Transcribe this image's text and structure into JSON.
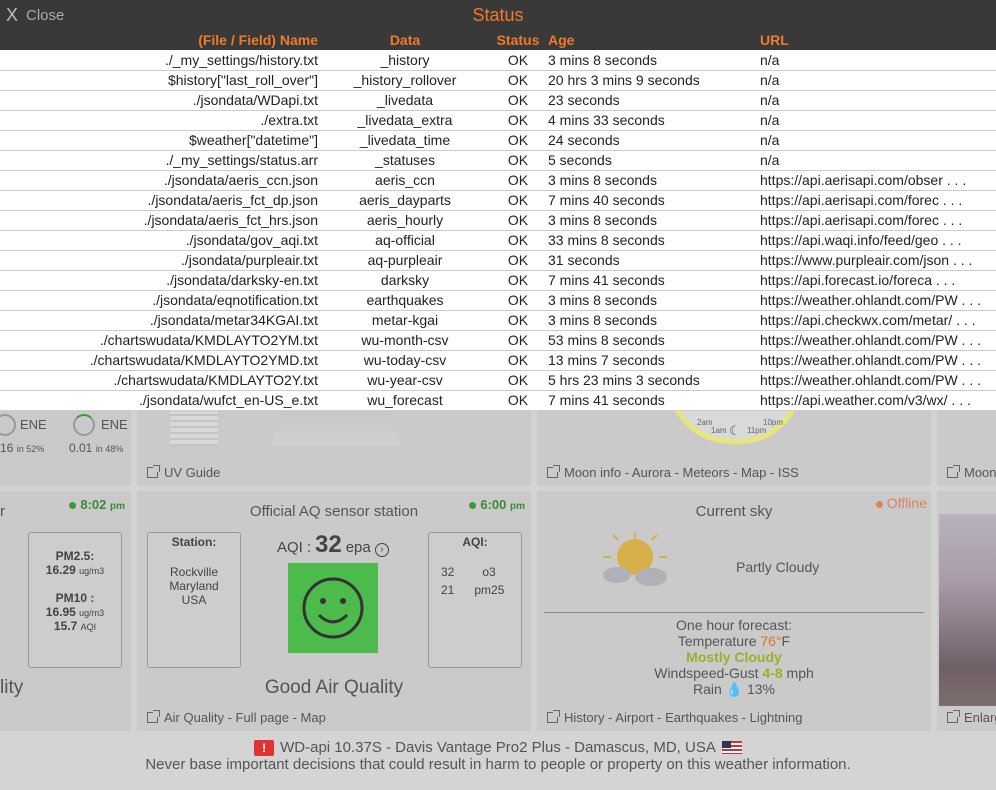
{
  "modal": {
    "close_x": "X",
    "close_label": "Close",
    "title": "Status",
    "columns": {
      "name": "(File / Field) Name",
      "data": "Data",
      "status": "Status",
      "age": "Age",
      "url": "URL"
    },
    "rows": [
      {
        "name": "./_my_settings/history.txt",
        "data": "_history",
        "status": "OK",
        "age": "3 mins 8 seconds",
        "url": "n/a"
      },
      {
        "name": "$history[\"last_roll_over\"]",
        "data": "_history_rollover",
        "status": "OK",
        "age": "20 hrs 3 mins 9 seconds",
        "url": "n/a"
      },
      {
        "name": "./jsondata/WDapi.txt",
        "data": "_livedata",
        "status": "OK",
        "age": "23 seconds",
        "url": "n/a"
      },
      {
        "name": "./extra.txt",
        "data": "_livedata_extra",
        "status": "OK",
        "age": "4 mins 33 seconds",
        "url": "n/a"
      },
      {
        "name": "$weather[\"datetime\"]",
        "data": "_livedata_time",
        "status": "OK",
        "age": "24 seconds",
        "url": "n/a"
      },
      {
        "name": "./_my_settings/status.arr",
        "data": "_statuses",
        "status": "OK",
        "age": "5 seconds",
        "url": "n/a"
      },
      {
        "name": "./jsondata/aeris_ccn.json",
        "data": "aeris_ccn",
        "status": "OK",
        "age": "3 mins 8 seconds",
        "url": "https://api.aerisapi.com/obser . . ."
      },
      {
        "name": "./jsondata/aeris_fct_dp.json",
        "data": "aeris_dayparts",
        "status": "OK",
        "age": "7 mins 40 seconds",
        "url": "https://api.aerisapi.com/forec . . ."
      },
      {
        "name": "./jsondata/aeris_fct_hrs.json",
        "data": "aeris_hourly",
        "status": "OK",
        "age": "3 mins 8 seconds",
        "url": "https://api.aerisapi.com/forec . . ."
      },
      {
        "name": "./jsondata/gov_aqi.txt",
        "data": "aq-official",
        "status": "OK",
        "age": "33 mins 8 seconds",
        "url": "https://api.waqi.info/feed/geo . . ."
      },
      {
        "name": "./jsondata/purpleair.txt",
        "data": "aq-purpleair",
        "status": "OK",
        "age": "31 seconds",
        "url": "https://www.purpleair.com/json . . ."
      },
      {
        "name": "./jsondata/darksky-en.txt",
        "data": "darksky",
        "status": "OK",
        "age": "7 mins 41 seconds",
        "url": "https://api.forecast.io/foreca . . ."
      },
      {
        "name": "./jsondata/eqnotification.txt",
        "data": "earthquakes",
        "status": "OK",
        "age": "3 mins 8 seconds",
        "url": "https://weather.ohlandt.com/PW . . ."
      },
      {
        "name": "./jsondata/metar34KGAI.txt",
        "data": "metar-kgai",
        "status": "OK",
        "age": "3 mins 8 seconds",
        "url": "https://api.checkwx.com/metar/ . . ."
      },
      {
        "name": "./chartswudata/KMDLAYTO2YM.txt",
        "data": "wu-month-csv",
        "status": "OK",
        "age": "53 mins 8 seconds",
        "url": "https://weather.ohlandt.com/PW . . ."
      },
      {
        "name": "./chartswudata/KMDLAYTO2YMD.txt",
        "data": "wu-today-csv",
        "status": "OK",
        "age": "13 mins 7 seconds",
        "url": "https://weather.ohlandt.com/PW . . ."
      },
      {
        "name": "./chartswudata/KMDLAYTO2Y.txt",
        "data": "wu-year-csv",
        "status": "OK",
        "age": "5 hrs 23 mins 3 seconds",
        "url": "https://weather.ohlandt.com/PW . . ."
      },
      {
        "name": "./jsondata/wufct_en-US_e.txt",
        "data": "wu_forecast",
        "status": "OK",
        "age": "7 mins 41 seconds",
        "url": "https://api.weather.com/v3/wx/ . . ."
      }
    ]
  },
  "dashboard": {
    "wind": {
      "dir1": "ENE",
      "dir2": "ENE",
      "val1": "16",
      "pct1": "in 52%",
      "val2": "0.01",
      "pct2": "in 48%"
    },
    "uv_link": "UV Guide",
    "moon": {
      "link": "Moon info - Aurora - Meteors - Map - ISS",
      "t1": "2am",
      "t2": "10pm",
      "t3": "1am",
      "t4": "11pm"
    },
    "moon_right_link": "Moon",
    "aq_left": {
      "time": "8:02",
      "time_suffix": "pm",
      "pm25_label": "PM2.5",
      "pm25_value": "16.29",
      "pm25_unit": "ug/m3",
      "pm10_label": "PM10",
      "pm10_value": "16.95",
      "pm10_unit": "ug/m3",
      "pm10_aqi": "15.7",
      "aqi_unit": "AQI",
      "footer_partial": "lity"
    },
    "aq_official": {
      "title": "Official AQ sensor station",
      "time": "6:00",
      "time_suffix": "pm",
      "station_label": "Station",
      "station_lines": [
        "Rockville",
        "Maryland",
        "USA"
      ],
      "aqi_label": "AQI",
      "aqi_value": "32",
      "aqi_unit": "epa",
      "aqi_right_label": "AQI",
      "aqi_rows": [
        {
          "v": "32",
          "k": "o3"
        },
        {
          "v": "21",
          "k": "pm25"
        }
      ],
      "quality": "Good Air Quality",
      "link": "Air Quality - Full page - Map",
      "face_color": "#4cbb4c"
    },
    "current_sky": {
      "title": "Current sky",
      "status": "Offline",
      "condition": "Partly Cloudy",
      "forecast_title": "One hour forecast:",
      "temp_label": "Temperature",
      "temp_value": "76°",
      "temp_unit": "F",
      "forecast_condition": "Mostly Cloudy",
      "wind_label": "Windspeed-Gust",
      "wind_value": "4-8",
      "wind_unit": "mph",
      "rain_label": "Rain",
      "rain_value": "13%",
      "link": "History - Airport - Earthquakes - Lightning"
    },
    "webcam_link": "Enlarg"
  },
  "banner": {
    "warn_icon": "!",
    "line1": "WD-api 10.37S  -  Davis Vantage Pro2 Plus  -  Damascus, MD, USA",
    "line2": "Never base important decisions that could result in harm to people or property on this weather information."
  },
  "colors": {
    "accent": "#f07a2a",
    "header_bg": "#393939",
    "ok_green": "#3a8a3a",
    "temp_orange": "#e0702a",
    "forecast_green": "#9aaf2a"
  }
}
